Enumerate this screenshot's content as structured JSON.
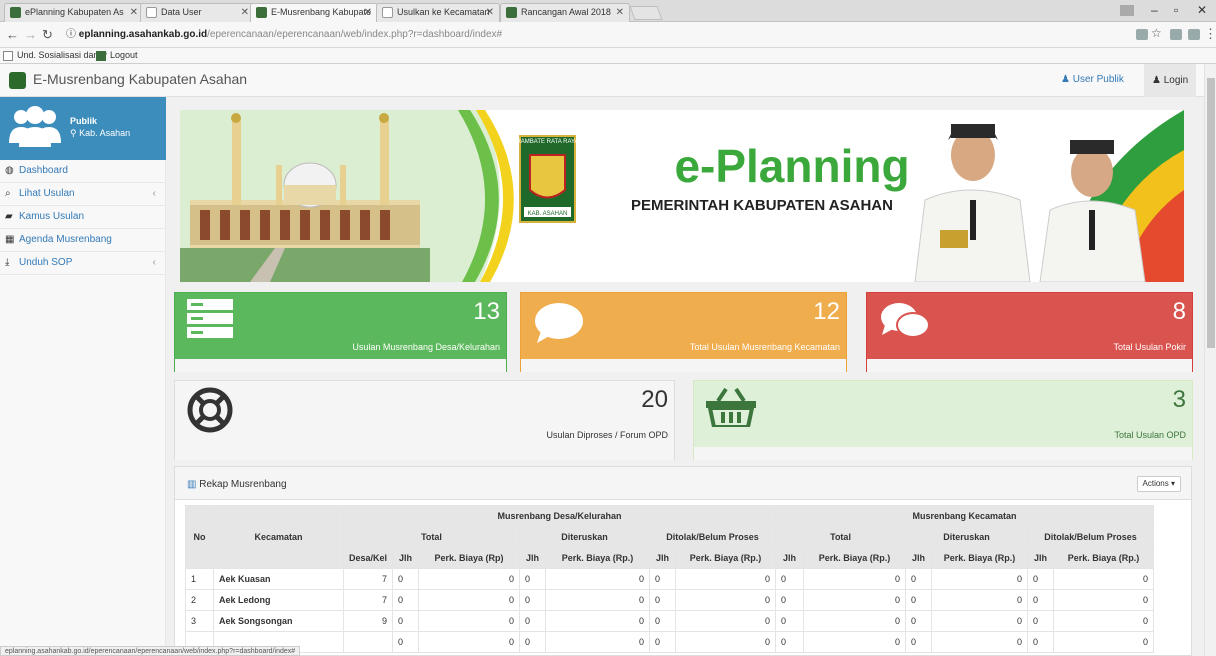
{
  "browser": {
    "tabs": [
      {
        "title": "ePlanning Kabupaten As",
        "fav": "green"
      },
      {
        "title": "Data User",
        "fav": "doc"
      },
      {
        "title": "E-Musrenbang Kabupate",
        "fav": "green",
        "active": true
      },
      {
        "title": "Usulkan ke Kecamatan",
        "fav": "doc"
      },
      {
        "title": "Rancangan Awal 2018",
        "fav": "green"
      }
    ],
    "url_host": "eplanning.asahankab.go.id",
    "url_path": "/eperencanaan/eperencanaan/web/index.php?r=dashboard/index#",
    "bookmarks": [
      "Und. Sosialisasi dan P",
      "Logout"
    ],
    "status_url": "eplanning.asahankab.go.id/eperencanaan/eperencanaan/web/index.php?r=dashboard/index#"
  },
  "header": {
    "title": "E-Musrenbang Kabupaten Asahan",
    "user_link": "User Publik",
    "login_link": "Login"
  },
  "sidebar": {
    "user_name": "Publik",
    "user_location": "Kab. Asahan",
    "items": [
      {
        "label": "Dashboard",
        "icon": "dashboard-icon",
        "glyph": "◍",
        "chev": false
      },
      {
        "label": "Lihat Usulan",
        "icon": "search-icon",
        "glyph": "⌕",
        "chev": true
      },
      {
        "label": "Kamus Usulan",
        "icon": "book-icon",
        "glyph": "▰",
        "chev": false
      },
      {
        "label": "Agenda Musrenbang",
        "icon": "calendar-icon",
        "glyph": "▦",
        "chev": false
      },
      {
        "label": "Unduh SOP",
        "icon": "download-icon",
        "glyph": "⤓",
        "chev": true
      }
    ]
  },
  "banner": {
    "logo_text_top": "RAMBATE RATA RAYA",
    "logo_text_bottom": "KAB. ASAHAN",
    "title": "e-Planning",
    "subtitle": "PEMERINTAH KABUPATEN ASAHAN"
  },
  "tiles": [
    {
      "value": "13",
      "label": "Usulan Musrenbang Desa/Kelurahan",
      "icon": "server-icon",
      "color": "#5cb85c"
    },
    {
      "value": "12",
      "label": "Total Usulan Musrenbang Kecamatan",
      "icon": "comment-icon",
      "color": "#f0ad4e"
    },
    {
      "value": "8",
      "label": "Total Usulan Pokir",
      "icon": "comments-icon",
      "color": "#d9534f"
    },
    {
      "value": "20",
      "label": "Usulan Diproses / Forum OPD",
      "icon": "lifebuoy-icon",
      "color": "#f5f5f5"
    },
    {
      "value": "3",
      "label": "Total Usulan OPD",
      "icon": "basket-icon",
      "color": "#dff0d8"
    }
  ],
  "recap": {
    "title": "Rekap Musrenbang",
    "actions_label": "Actions",
    "headers": {
      "no": "No",
      "kecamatan": "Kecamatan",
      "desa_group": "Musrenbang Desa/Kelurahan",
      "kec_group": "Musrenbang Kecamatan",
      "total": "Total",
      "diteruskan": "Diteruskan",
      "ditolak": "Ditolak/Belum Proses",
      "desakel": "Desa/Kel",
      "jlh": "Jlh",
      "biaya": "Perk. Biaya (Rp)",
      "biaya_dot": "Perk. Biaya (Rp.)"
    },
    "rows": [
      {
        "no": "1",
        "kecamatan": "Aek Kuasan",
        "desakel": "7",
        "cells": [
          "0",
          "0",
          "0",
          "0",
          "0",
          "0",
          "0",
          "0",
          "0",
          "0",
          "0",
          "0"
        ]
      },
      {
        "no": "2",
        "kecamatan": "Aek Ledong",
        "desakel": "7",
        "cells": [
          "0",
          "0",
          "0",
          "0",
          "0",
          "0",
          "0",
          "0",
          "0",
          "0",
          "0",
          "0"
        ]
      },
      {
        "no": "3",
        "kecamatan": "Aek Songsongan",
        "desakel": "9",
        "cells": [
          "0",
          "0",
          "0",
          "0",
          "0",
          "0",
          "0",
          "0",
          "0",
          "0",
          "0",
          "0"
        ]
      },
      {
        "no": "",
        "kecamatan": "",
        "desakel": "",
        "cells": [
          "0",
          "0",
          "0",
          "0",
          "0",
          "0",
          "0",
          "0",
          "0",
          "0",
          "0",
          "0"
        ]
      }
    ]
  }
}
